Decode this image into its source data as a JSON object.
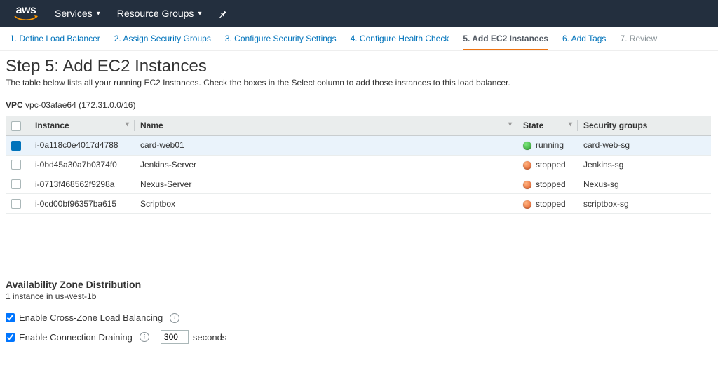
{
  "topnav": {
    "logo": "aws",
    "services": "Services",
    "resource_groups": "Resource Groups"
  },
  "wizard": {
    "steps": [
      "1. Define Load Balancer",
      "2. Assign Security Groups",
      "3. Configure Security Settings",
      "4. Configure Health Check",
      "5. Add EC2 Instances",
      "6. Add Tags",
      "7. Review"
    ],
    "active_index": 4
  },
  "step": {
    "title": "Step 5: Add EC2 Instances",
    "description": "The table below lists all your running EC2 Instances. Check the boxes in the Select column to add those instances to this load balancer."
  },
  "vpc": {
    "label": "VPC",
    "value": "vpc-03afae64 (172.31.0.0/16)"
  },
  "table": {
    "headers": {
      "instance": "Instance",
      "name": "Name",
      "state": "State",
      "security_groups": "Security groups"
    },
    "rows": [
      {
        "selected": true,
        "instance": "i-0a118c0e4017d4788",
        "name": "card-web01",
        "state": "running",
        "sg": "card-web-sg"
      },
      {
        "selected": false,
        "instance": "i-0bd45a30a7b0374f0",
        "name": "Jenkins-Server",
        "state": "stopped",
        "sg": "Jenkins-sg"
      },
      {
        "selected": false,
        "instance": "i-0713f468562f9298a",
        "name": "Nexus-Server",
        "state": "stopped",
        "sg": "Nexus-sg"
      },
      {
        "selected": false,
        "instance": "i-0cd00bf96357ba615",
        "name": "Scriptbox",
        "state": "stopped",
        "sg": "scriptbox-sg"
      }
    ]
  },
  "az": {
    "title": "Availability Zone Distribution",
    "summary": "1 instance in us-west-1b",
    "cross_zone_label": "Enable Cross-Zone Load Balancing",
    "cross_zone_checked": true,
    "drain_label": "Enable Connection Draining",
    "drain_checked": true,
    "drain_seconds": "300",
    "seconds_label": "seconds"
  }
}
